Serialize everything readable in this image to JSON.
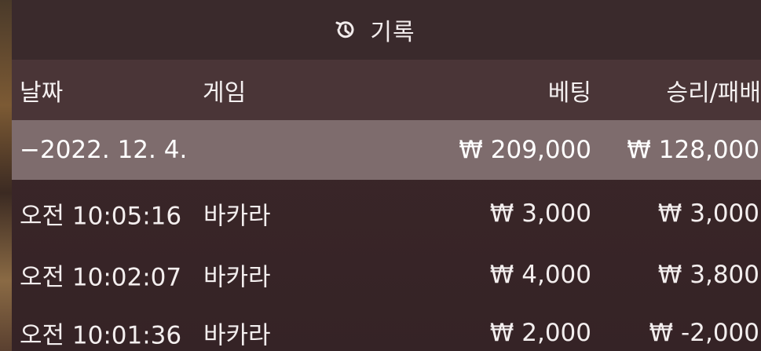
{
  "header": {
    "title": "기록",
    "icon": "history-icon"
  },
  "columns": {
    "date": "날짜",
    "game": "게임",
    "bet": "베팅",
    "winloss": "승리/패배"
  },
  "date_group": {
    "label": "−2022. 12. 4.",
    "bet_total": "₩ 209,000",
    "winloss_total": "₩ 128,000"
  },
  "rows": [
    {
      "time": "오전 10:05:16",
      "game": "바카라",
      "bet": "₩ 3,000",
      "winloss": "₩ 3,000"
    },
    {
      "time": "오전 10:02:07",
      "game": "바카라",
      "bet": "₩ 4,000",
      "winloss": "₩ 3,800"
    },
    {
      "time": "오전 10:01:36",
      "game": "바카라",
      "bet": "₩ 2,000",
      "winloss": "₩ -2,000"
    }
  ]
}
